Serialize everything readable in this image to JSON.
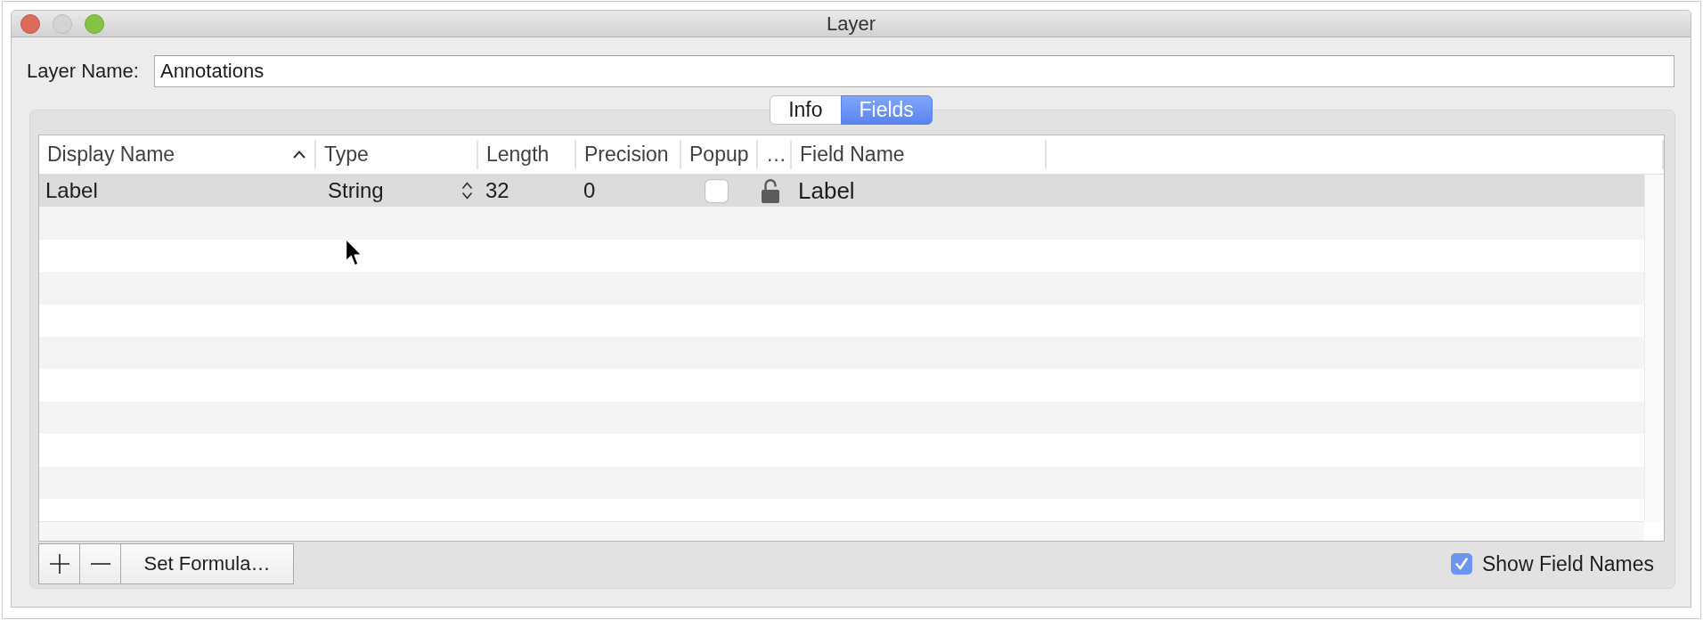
{
  "window": {
    "title": "Layer",
    "controls": [
      {
        "kind": "close",
        "disabled": false
      },
      {
        "kind": "minimize",
        "disabled": true
      },
      {
        "kind": "zoom",
        "disabled": false
      }
    ]
  },
  "layer_name": {
    "label": "Layer Name:",
    "value": "Annotations"
  },
  "tabs": [
    {
      "label": "Info",
      "selected": false
    },
    {
      "label": "Fields",
      "selected": true
    }
  ],
  "table": {
    "columns": [
      {
        "label": "Display Name",
        "sorted": true
      },
      {
        "label": "Type",
        "sorted": false
      },
      {
        "label": "Length",
        "sorted": false
      },
      {
        "label": "Precision",
        "sorted": false
      },
      {
        "label": "Popup",
        "sorted": false
      },
      {
        "label": "…",
        "sorted": false
      },
      {
        "label": "Field Name",
        "sorted": false
      }
    ],
    "rows": [
      {
        "display_name": "Label",
        "type": "String",
        "length": "32",
        "precision": "0",
        "popup": false,
        "locked": false,
        "field_name": "Label",
        "selected": true
      }
    ]
  },
  "footer": {
    "formula_button": "Set Formula…",
    "show_field_names": {
      "label": "Show Field Names",
      "checked": true
    }
  }
}
